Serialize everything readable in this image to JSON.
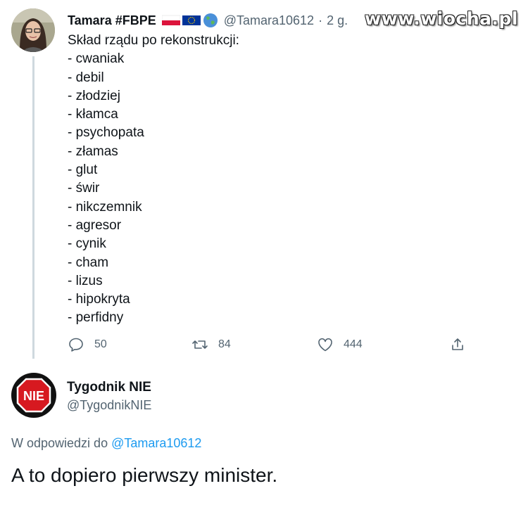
{
  "watermark": "www.wiocha.pl",
  "tweet1": {
    "author_name": "Tamara #FBPE",
    "badges": [
      "poland-flag-icon",
      "eu-flag-icon",
      "globe-icon"
    ],
    "handle": "@Tamara10612",
    "separator": "·",
    "time": "2 g.",
    "text_lines": [
      "Skład rządu po rekonstrukcji:",
      "- cwaniak",
      "- debil",
      "- złodziej",
      "- kłamca",
      "- psychopata",
      "- złamas",
      "- glut",
      "- świr",
      "- nikczemnik",
      "- agresor",
      "- cynik",
      "- cham",
      "- lizus",
      "- hipokryta",
      "- perfidny"
    ],
    "actions": {
      "reply_count": "50",
      "retweet_count": "84",
      "like_count": "444"
    }
  },
  "tweet2": {
    "avatar_text": "NIE",
    "author_name": "Tygodnik NIE",
    "handle": "@TygodnikNIE",
    "reply_prefix": "W odpowiedzi do",
    "reply_mention": "@Tamara10612",
    "text": "A to dopiero pierwszy minister."
  },
  "colors": {
    "accent": "#1d9bf0",
    "secondary_text": "#536471",
    "primary_text": "#0f1419",
    "thread_line": "#cfd9de",
    "nie_red": "#d71920"
  }
}
